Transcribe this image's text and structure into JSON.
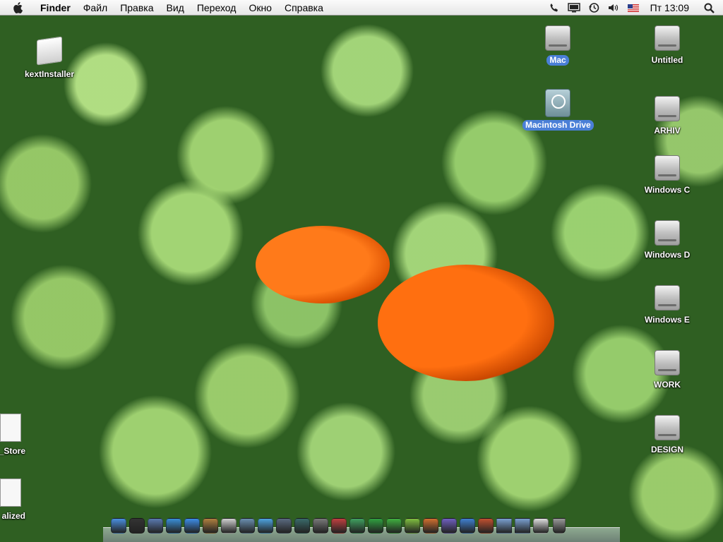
{
  "menubar": {
    "app_name": "Finder",
    "menus": [
      "Файл",
      "Правка",
      "Вид",
      "Переход",
      "Окно",
      "Справка"
    ],
    "extras": [
      "phone-icon",
      "display-icon",
      "time-machine-icon",
      "volume-icon",
      "flag-us-icon"
    ],
    "clock": "Пт 13:09"
  },
  "desktop_icons": [
    {
      "label": "kextInstaller",
      "icon": "package-icon",
      "selected": false
    },
    {
      "label": "Mac",
      "icon": "hard-drive-icon",
      "selected": true
    },
    {
      "label": "Macintosh Drive",
      "icon": "time-machine-drive-icon",
      "selected": true
    },
    {
      "label": "Untitled",
      "icon": "hard-drive-icon",
      "selected": false
    },
    {
      "label": "ARHIV",
      "icon": "hard-drive-icon",
      "selected": false
    },
    {
      "label": "Windows C",
      "icon": "hard-drive-icon",
      "selected": false
    },
    {
      "label": "Windows D",
      "icon": "hard-drive-icon",
      "selected": false
    },
    {
      "label": "Windows E",
      "icon": "hard-drive-icon",
      "selected": false
    },
    {
      "label": "WORK",
      "icon": "hard-drive-icon",
      "selected": false
    },
    {
      "label": "DESIGN",
      "icon": "hard-drive-icon",
      "selected": false
    },
    {
      "label": "_Store",
      "icon": "document-icon",
      "selected": false
    },
    {
      "label": "alized",
      "icon": "document-icon",
      "selected": false
    }
  ],
  "dock": [
    {
      "name": "finder",
      "color": "#4a8fe0"
    },
    {
      "name": "dashboard",
      "color": "#333333"
    },
    {
      "name": "preview",
      "color": "#5a7ab0"
    },
    {
      "name": "safari",
      "color": "#3a8fd8"
    },
    {
      "name": "ichat",
      "color": "#3d8de8"
    },
    {
      "name": "address-book",
      "color": "#b08040"
    },
    {
      "name": "ical",
      "color": "#d0d0d0"
    },
    {
      "name": "iphoto",
      "color": "#6a8fb0"
    },
    {
      "name": "itunes",
      "color": "#4ea3e0"
    },
    {
      "name": "spaces",
      "color": "#5a6a80"
    },
    {
      "name": "time-machine",
      "color": "#3a6a6a"
    },
    {
      "name": "system-preferences",
      "color": "#7a7a7a"
    },
    {
      "name": "app-1",
      "color": "#c04040"
    },
    {
      "name": "app-2",
      "color": "#40a060"
    },
    {
      "name": "app-3",
      "color": "#30a040"
    },
    {
      "name": "office-word",
      "color": "#40b040"
    },
    {
      "name": "office-excel",
      "color": "#80c040"
    },
    {
      "name": "office-powerpoint",
      "color": "#d07030"
    },
    {
      "name": "office-entourage",
      "color": "#7060c0"
    },
    {
      "name": "messenger",
      "color": "#4080d0"
    },
    {
      "name": "app-4",
      "color": "#c05030"
    },
    {
      "name": "applications-folder",
      "color": "#7aa0d0"
    },
    {
      "name": "documents-folder",
      "color": "#7aa0d0"
    },
    {
      "name": "app-5",
      "color": "#e0e0e0"
    },
    {
      "name": "trash",
      "color": "#9a9a9a"
    }
  ]
}
